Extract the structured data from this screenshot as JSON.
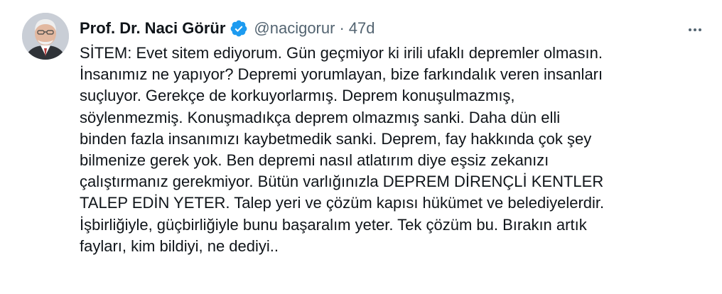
{
  "tweet": {
    "author_name": "Prof. Dr. Naci Görür",
    "handle": "@nacigorur",
    "separator": "·",
    "time": "47d",
    "verified_icon": "verified-badge-icon",
    "more_icon": "more-horizontal-icon",
    "text": "SİTEM: Evet sitem ediyorum. Gün geçmiyor ki irili ufaklı depremler olmasın.\nİnsanımız ne yapıyor? Depremi yorumlayan, bize farkındalık veren insanları\nsuçluyor. Gerekçe de korkuyorlarmış. Deprem konuşulmazmış,\nsöylenmezmiş. Konuşmadıkça deprem olmazmış sanki. Daha dün elli\nbinden fazla insanımızı kaybetmedik sanki. Deprem, fay hakkında çok şey\nbilmenize gerek yok. Ben depremi nasıl atlatırım diye eşsiz zekanızı\nçalıştırmanız gerekmiyor. Bütün varlığınızla DEPREM DİRENÇLİ KENTLER\nTALEP EDİN YETER. Talep yeri ve çözüm kapısı hükümet ve belediyelerdir.\nİşbirliğiyle, güçbirliğiyle bunu başaralım yeter. Tek çözüm bu. Bırakın artık\nfayları, kim bildiyi, ne dediyi.."
  },
  "colors": {
    "text_primary": "#0f1419",
    "text_secondary": "#536471",
    "verified_blue": "#1d9bf0",
    "background": "#ffffff"
  }
}
